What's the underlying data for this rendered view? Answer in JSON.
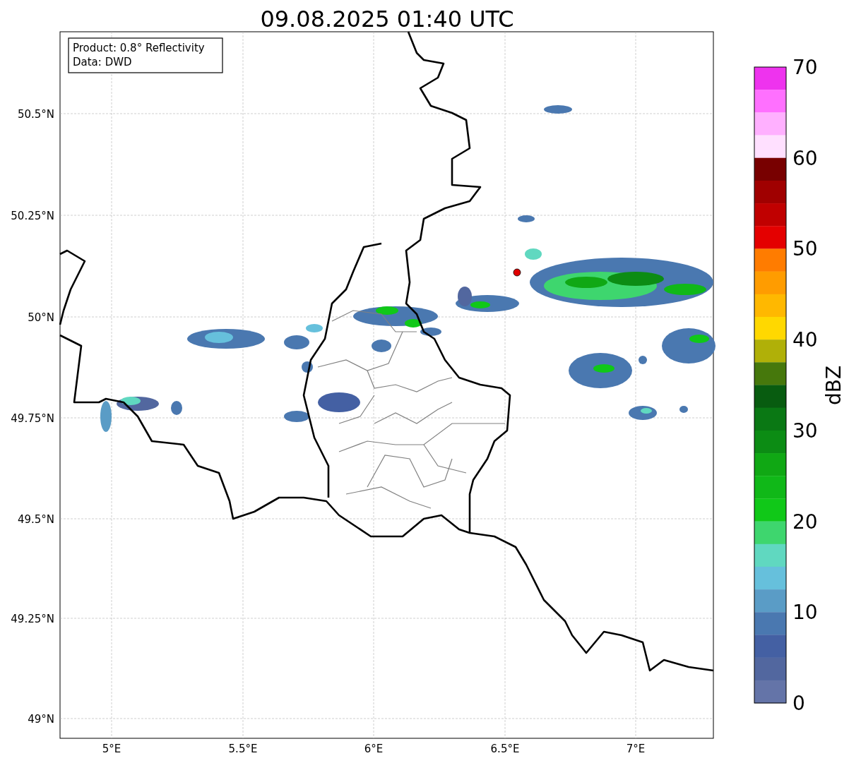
{
  "title": "09.08.2025 01:40 UTC",
  "info_box": [
    "Product: 0.8° Reflectivity",
    "Data: DWD"
  ],
  "lat_ticks": [
    "50.5°N",
    "50.25°N",
    "50°N",
    "49.75°N",
    "49.5°N",
    "49.25°N",
    "49°N"
  ],
  "lon_ticks": [
    "5°E",
    "5.5°E",
    "6°E",
    "6.5°E",
    "7°E"
  ],
  "colorbar": {
    "label": "dBZ",
    "ticks": [
      "70",
      "60",
      "50",
      "40",
      "30",
      "20",
      "10",
      "0"
    ],
    "bands": [
      {
        "color": "#ee33ee"
      },
      {
        "color": "#ff70ff"
      },
      {
        "color": "#ffb0ff"
      },
      {
        "color": "#ffe0ff"
      },
      {
        "color": "#780000"
      },
      {
        "color": "#a00000"
      },
      {
        "color": "#c00000"
      },
      {
        "color": "#e40000"
      },
      {
        "color": "#ff7c00"
      },
      {
        "color": "#ff9c00"
      },
      {
        "color": "#ffb800"
      },
      {
        "color": "#ffd800"
      },
      {
        "color": "#b0b008"
      },
      {
        "color": "#46780c"
      },
      {
        "color": "#085c10"
      },
      {
        "color": "#0a7814"
      },
      {
        "color": "#0c8c14"
      },
      {
        "color": "#10a814"
      },
      {
        "color": "#10b818"
      },
      {
        "color": "#10c818"
      },
      {
        "color": "#3ed66e"
      },
      {
        "color": "#60d8c0"
      },
      {
        "color": "#66c0dc"
      },
      {
        "color": "#5a9cc6"
      },
      {
        "color": "#4a78b0"
      },
      {
        "color": "#4460a3"
      },
      {
        "color": "#52679f"
      },
      {
        "color": "#6474a8"
      }
    ]
  }
}
